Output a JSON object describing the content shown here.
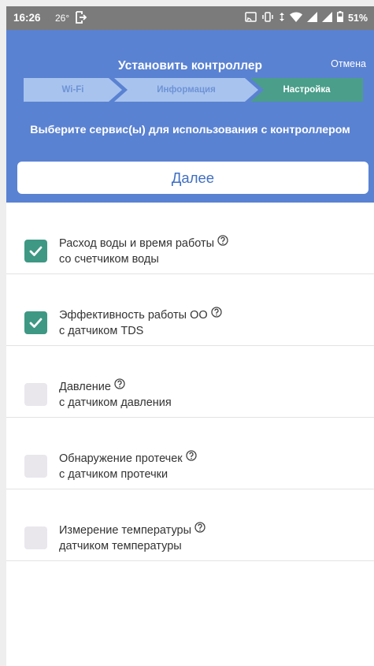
{
  "status_bar": {
    "time": "16:26",
    "temperature": "26°",
    "battery": "51%"
  },
  "header": {
    "title": "Установить контроллер",
    "cancel_label": "Отмена",
    "steps": [
      {
        "label": "Wi-Fi",
        "state": "done"
      },
      {
        "label": "Информация",
        "state": "done"
      },
      {
        "label": "Настройка",
        "state": "active"
      }
    ],
    "subtitle": "Выберите сервис(ы) для использования с контроллером",
    "next_label": "Далее"
  },
  "services": [
    {
      "title": "Расход воды и время работы",
      "subtitle": "со счетчиком воды",
      "checked": true
    },
    {
      "title": "Эффективность работы ОО",
      "subtitle": "с датчиком TDS",
      "checked": true
    },
    {
      "title": "Давление",
      "subtitle": "с датчиком давления",
      "checked": false
    },
    {
      "title": "Обнаружение протечек",
      "subtitle": "с датчиком протечки",
      "checked": false
    },
    {
      "title": "Измерение температуры",
      "subtitle": "датчиком температуры",
      "checked": false
    }
  ],
  "colors": {
    "header_bg": "#5a82d2",
    "step_done_bg": "#a8c3ee",
    "step_active_bg": "#4a9e8a",
    "checkbox_checked": "#3e9884",
    "checkbox_unchecked": "#e9e6ec",
    "next_text": "#3f6fc4"
  },
  "icons": {
    "status_left": [
      "exit-icon"
    ],
    "status_right": [
      "cast-icon",
      "vibrate-icon",
      "data-arrows-icon",
      "wifi-icon",
      "signal-icon",
      "signal-icon",
      "battery-icon"
    ],
    "help": "question-circle-icon",
    "check": "check-icon"
  }
}
